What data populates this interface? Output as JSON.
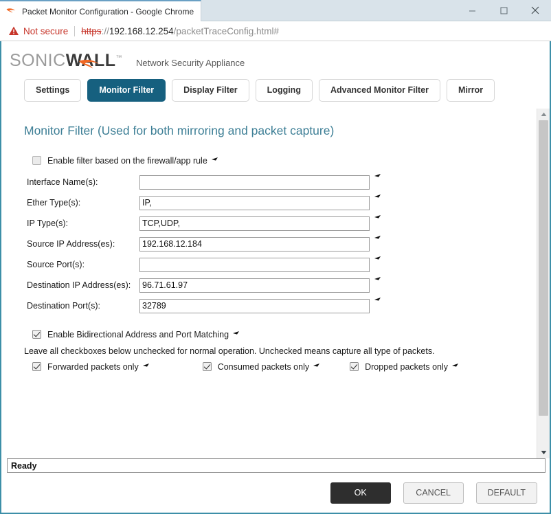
{
  "browser": {
    "tab_title": "Packet Monitor Configuration - Google Chrome",
    "favicon": "sonicwall-favicon",
    "security_label": "Not secure",
    "url_scheme": "https",
    "url_separator": "://",
    "url_host": "192.168.12.254",
    "url_path": "/packetTraceConfig.html#",
    "minimize_label": "Minimize",
    "maximize_label": "Maximize",
    "close_label": "Close"
  },
  "brand": {
    "logo_part1": "SONIC",
    "logo_part2": "WALL",
    "trademark": "™",
    "subtitle": "Network Security Appliance"
  },
  "tabs": [
    {
      "label": "Settings",
      "active": false
    },
    {
      "label": "Monitor Filter",
      "active": true
    },
    {
      "label": "Display Filter",
      "active": false
    },
    {
      "label": "Logging",
      "active": false
    },
    {
      "label": "Advanced Monitor Filter",
      "active": false
    },
    {
      "label": "Mirror",
      "active": false
    }
  ],
  "main": {
    "section_title": "Monitor Filter (Used for both mirroring and packet capture)",
    "enable_rule_filter": {
      "label": "Enable filter based on the firewall/app rule",
      "checked": false
    },
    "fields": [
      {
        "label": "Interface Name(s):",
        "value": "",
        "placeholder": ""
      },
      {
        "label": "Ether Type(s):",
        "value": "IP,",
        "placeholder": ""
      },
      {
        "label": "IP Type(s):",
        "value": "TCP,UDP,",
        "placeholder": ""
      },
      {
        "label": "Source IP Address(es):",
        "value": "192.168.12.184",
        "placeholder": ""
      },
      {
        "label": "Source Port(s):",
        "value": "",
        "placeholder": ""
      },
      {
        "label": "Destination IP Address(es):",
        "value": "96.71.61.97",
        "placeholder": ""
      },
      {
        "label": "Destination Port(s):",
        "value": "32789",
        "placeholder": ""
      }
    ],
    "bidirectional": {
      "label": "Enable Bidirectional Address and Port Matching",
      "checked": true
    },
    "note": "Leave all checkboxes below unchecked for normal operation. Unchecked means capture all type of packets.",
    "packet_options": [
      {
        "label": "Forwarded packets only",
        "checked": true
      },
      {
        "label": "Consumed packets only",
        "checked": true
      },
      {
        "label": "Dropped packets only",
        "checked": true
      }
    ]
  },
  "status": {
    "text": "Ready"
  },
  "footer": {
    "ok_label": "OK",
    "cancel_label": "CANCEL",
    "default_label": "DEFAULT"
  },
  "colors": {
    "accent_teal": "#16607f",
    "frame_teal": "#3d8fa8",
    "heading_teal": "#3e7f96",
    "brand_orange": "#f06723",
    "warning_red": "#c7352a",
    "ok_button": "#2e2e2e"
  }
}
